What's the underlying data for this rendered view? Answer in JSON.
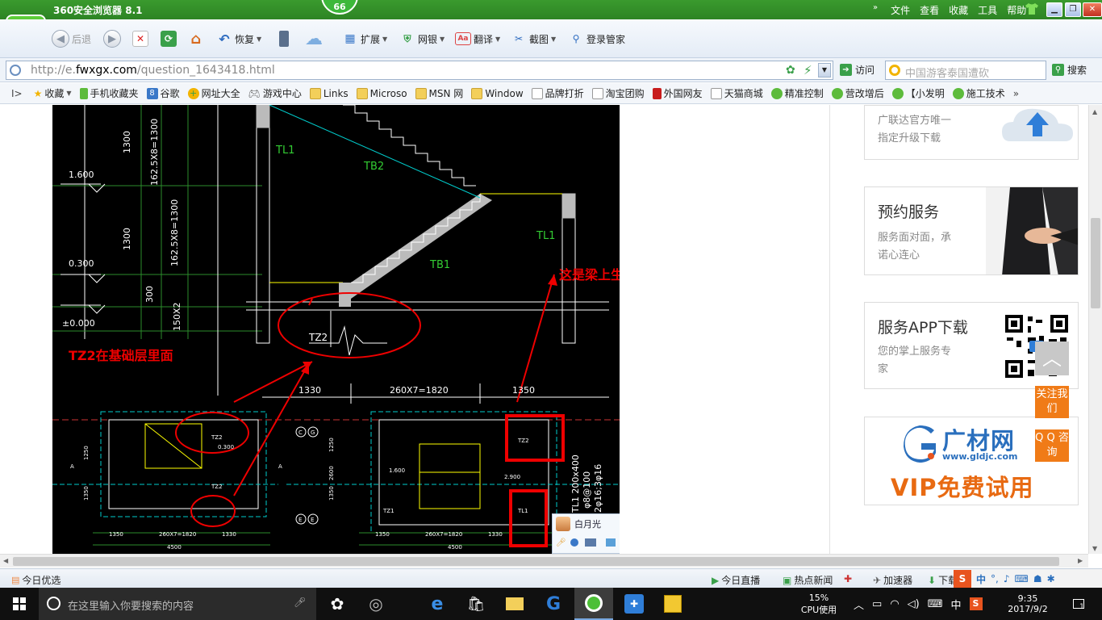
{
  "window": {
    "title": "360安全浏览器 8.1",
    "badge": "66",
    "menu": [
      "文件",
      "查看",
      "收藏",
      "工具",
      "帮助"
    ]
  },
  "toolbar": {
    "back": "后退",
    "restore": "恢复",
    "extend": "扩展",
    "bank": "网银",
    "translate": "翻译",
    "screenshot": "截图",
    "login_manager": "登录管家"
  },
  "address": {
    "url_prefix": "http://e.",
    "url_domain": "fwxgx.com",
    "url_path": "/question_1643418.html",
    "visit": "访问",
    "search_placeholder": "中国游客泰国遭砍",
    "search": "搜索"
  },
  "bookmarks": [
    "收藏",
    "手机收藏夹",
    "谷歌",
    "网址大全",
    "游戏中心",
    "Links",
    "Microso",
    "MSN 网",
    "Window",
    "品牌打折",
    "淘宝团购",
    "外国网友",
    "天猫商城",
    "精准控制",
    "营改增后",
    "【小发明",
    "施工技术"
  ],
  "cad": {
    "levels": [
      "1.600",
      "0.300",
      "±0.000"
    ],
    "dims_v": [
      "1300",
      "162.5X8=1300",
      "1300",
      "162.5X8=1300",
      "300",
      "150X2"
    ],
    "dims_h": [
      "1330",
      "260X7=1820",
      "1350"
    ],
    "labels": [
      "TL1",
      "TB2",
      "TL1",
      "TB1",
      "TZ2"
    ],
    "annotation_left": "TZ2在基础层里面",
    "annotation_right": "这是梁上生成TZ1",
    "plan_left_dims": [
      "1350",
      "260X7=1820",
      "1330",
      "4500"
    ],
    "plan_right_dims": [
      "1350",
      "260X7=1820",
      "1330",
      "4500"
    ],
    "plan_axes": [
      "C",
      "G",
      "E",
      "E",
      "A",
      "A"
    ],
    "plan_notes": [
      "TZ2",
      "TZ2",
      "TZ1",
      "TZ2",
      "TL1",
      "0.300",
      "1.600",
      "2.900",
      "1250",
      "1350",
      "2600",
      "1250",
      "1350",
      "TL1 200x400",
      "φ8@100",
      "2φ16;3φ16"
    ],
    "chat_name": "白月光"
  },
  "sidebar": {
    "card1_line1": "广联达官方唯一",
    "card1_line2": "指定升级下载",
    "card2_title": "预约服务",
    "card2_line1": "服务面对面，承",
    "card2_line2": "诺心连心",
    "card3_title": "服务APP下载",
    "card3_line1": "您的掌上服务专",
    "card3_line2": "家",
    "card4_brand": "广材网",
    "card4_url": "www.gldjc.com",
    "card4_vip": "VIP免费试用",
    "follow": "关注我们",
    "qq": "Q Q 咨询"
  },
  "statusbar": {
    "today_pick": "今日优选",
    "live": "今日直播",
    "hot_news": "热点新闻",
    "accelerator": "加速器",
    "download": "下载",
    "ime": "中"
  },
  "taskbar": {
    "search_placeholder": "在这里输入你要搜索的内容",
    "cpu_pct": "15%",
    "cpu_label": "CPU使用",
    "ime": "中",
    "time": "9:35",
    "date": "2017/9/2",
    "notif_count": "1"
  }
}
